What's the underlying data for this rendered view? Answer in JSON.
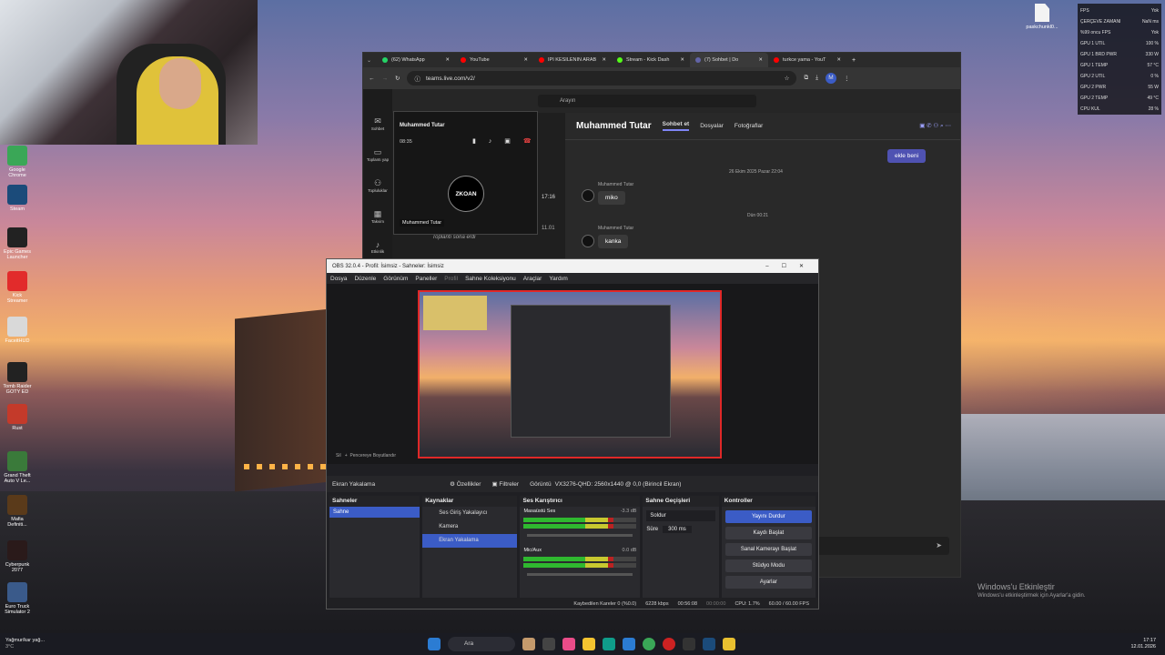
{
  "desktop": {
    "icons": [
      {
        "label": "Google Chrome",
        "icon": "chrome-icon",
        "color": "#3aa757"
      },
      {
        "label": "Steam",
        "icon": "steam-icon",
        "color": "#1b4b7a"
      },
      {
        "label": "Epic Games Launcher",
        "icon": "epic-icon",
        "color": "#222222"
      },
      {
        "label": "Kick Streamer",
        "icon": "kick-icon",
        "color": "#e22b2b"
      },
      {
        "label": "FaceitHUD",
        "icon": "faceit-icon",
        "color": "#d9d9d9"
      },
      {
        "label": "Tomb Raider GOTY ED",
        "icon": "tr-icon",
        "color": "#222222"
      },
      {
        "label": "Rust",
        "icon": "rust-icon",
        "color": "#c43a2a"
      },
      {
        "label": "Grand Theft Auto V Le...",
        "icon": "gta-icon",
        "color": "#3a7a3a"
      },
      {
        "label": "Mafia Definiti...",
        "icon": "mafia-icon",
        "color": "#5a3a1a"
      },
      {
        "label": "Cyberpunk 2077",
        "icon": "cyberpunk-icon",
        "color": "#2a1a1a"
      },
      {
        "label": "Euro Truck Simulator 2",
        "icon": "ets-icon",
        "color": "#3a5a8a"
      }
    ],
    "top_file": "paskchunkl0...",
    "activation": {
      "title": "Windows'u Etkinleştir",
      "subtitle": "Windows'u etkinleştirmek için Ayarlar'a gidin."
    }
  },
  "stats": [
    {
      "k": "FPS",
      "v": "Yok"
    },
    {
      "k": "ÇERÇEVE ZAMANI",
      "v": "NaN ms"
    },
    {
      "k": "%99 oncu FPS",
      "v": "Yok"
    },
    {
      "k": "GPU 1 UTIL",
      "v": "100 %"
    },
    {
      "k": "GPU 1 BRD PWR",
      "v": "330 W"
    },
    {
      "k": "GPU 1 TEMP",
      "v": "57 °C"
    },
    {
      "k": "GPU 2 UTIL",
      "v": "0 %"
    },
    {
      "k": "GPU 2 PWR",
      "v": "55 W"
    },
    {
      "k": "GPU 2 TEMP",
      "v": "49 °C"
    },
    {
      "k": "CPU KUL",
      "v": "28 %"
    }
  ],
  "browser": {
    "tabs": [
      {
        "label": "(62) WhatsApp",
        "color": "#25d366"
      },
      {
        "label": "YouTube",
        "color": "#ff0000"
      },
      {
        "label": "IPİ KESİLENİN ARAB",
        "color": "#ff0000"
      },
      {
        "label": "Stream - Kick Dash",
        "color": "#53fc18"
      },
      {
        "label": "(7) Sohbet | Do",
        "color": "#6264a7"
      },
      {
        "label": "turkce yama - YouT",
        "color": "#ff0000"
      }
    ],
    "url": "teams.live.com/v2/",
    "profile": "M"
  },
  "teams": {
    "search": "Arayın",
    "rail": [
      "Sohbet",
      "Toplantı yap",
      "Topluluklar",
      "Takvim",
      "Etkinlik"
    ],
    "chat_name": "Muhammed Tutar",
    "chat_tabs": [
      "Sohbet et",
      "Dosyalar",
      "Fotoğraflar"
    ],
    "my_bubble": "ekle beni",
    "date1": "26 Ekim 2025 Pazar 22:04",
    "msg1_sender": "Muhammed Tutar",
    "msg1": "miko",
    "date2": "Dün 00:21",
    "msg2_sender": "Muhammed Tutar",
    "msg2": "kanka",
    "list_time1": "17:16",
    "list_time2": "11.01",
    "list_preview": "Toplantı sona erdi",
    "pip": {
      "name": "Muhammed Tutar",
      "duration": "08:35",
      "avatar": "ZKOAN",
      "footer": "Muhammed Tutar"
    }
  },
  "obs": {
    "title": "OBS 32.0.4 - Profil: İsimsiz - Sahneler: İsimsiz",
    "menu": [
      "Dosya",
      "Düzenle",
      "Görünüm",
      "Paneller",
      "Profil",
      "Sahne Koleksiyonu",
      "Araçlar",
      "Yardım"
    ],
    "preview_toolbar": [
      "Sil",
      "Pencereye Boyutlandır"
    ],
    "source_bar": {
      "name": "Ekran Yakalama",
      "props": "Özellikler",
      "filters": "Filtreler",
      "display_label": "Görüntü",
      "display_value": "VX3276-QHD: 2560x1440 @ 0,0 (Birincil Ekran)"
    },
    "scenes": {
      "title": "Sahneler",
      "items": [
        "Sahne"
      ]
    },
    "sources": {
      "title": "Kaynaklar",
      "items": [
        "Ses Giriş Yakalayıcı",
        "Kamera",
        "Ekran Yakalama"
      ]
    },
    "mixer": {
      "title": "Ses Karıştırıcı",
      "tracks": [
        {
          "name": "Masaüstü Ses",
          "db": "-3.3 dB"
        },
        {
          "name": "Mic/Aux",
          "db": "0.0 dB"
        }
      ]
    },
    "transitions": {
      "title": "Sahne Geçişleri",
      "type": "Soldur",
      "duration_label": "Süre",
      "duration": "300 ms"
    },
    "controls": {
      "title": "Kontroller",
      "buttons": [
        "Yayını Durdur",
        "Kaydı Başlat",
        "Sanal Kamerayı Başlat",
        "Stüdyo Modu",
        "Ayarlar"
      ]
    },
    "status": {
      "dropped": "Kaybedilen Kareler 0 (%0.0)",
      "bitrate": "6228 kbps",
      "stream_time": "00:56:08",
      "rec_time": "00:00:00",
      "cpu": "CPU: 1.7%",
      "fps": "60.00 / 60.00 FPS"
    }
  },
  "taskbar": {
    "weather": "Yağmur/kar yağ...",
    "temp": "3°C",
    "search": "Ara",
    "time": "17:17",
    "date": "12.01.2026"
  }
}
